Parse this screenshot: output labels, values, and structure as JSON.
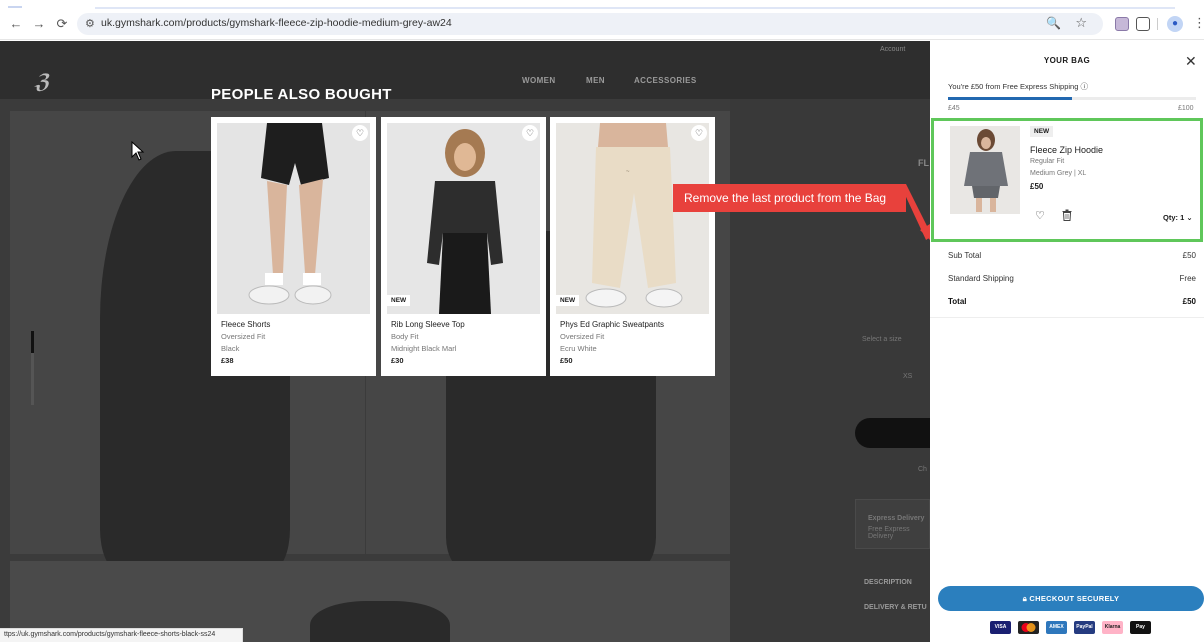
{
  "browser": {
    "url": "uk.gymshark.com/products/gymshark-fleece-zip-hoodie-medium-grey-aw24",
    "status_url": "ttps://uk.gymshark.com/products/gymshark-fleece-shorts-black-ss24"
  },
  "page": {
    "nav": [
      "WOMEN",
      "MEN",
      "ACCESSORIES"
    ],
    "account": "Account",
    "right_partial": {
      "title_fragment": "FL",
      "size_label": "Select a size",
      "ch": "Ch",
      "xs": "XS",
      "express": "Express Delivery",
      "express_sub": "Free Express Delivery",
      "description": "DESCRIPTION",
      "delivery": "DELIVERY & RETU"
    }
  },
  "also_bought": {
    "title": "PEOPLE ALSO BOUGHT",
    "products": [
      {
        "name": "Fleece Shorts",
        "fit": "Oversized Fit",
        "color": "Black",
        "price": "£38",
        "badge": ""
      },
      {
        "name": "Rib Long Sleeve Top",
        "fit": "Body Fit",
        "color": "Midnight Black Marl",
        "price": "£30",
        "badge": "NEW"
      },
      {
        "name": "Phys Ed Graphic Sweatpants",
        "fit": "Oversized Fit",
        "color": "Ecru White",
        "price": "£50",
        "badge": "NEW"
      }
    ]
  },
  "annotation": "Remove the last product from the Bag",
  "bag": {
    "title": "YOUR BAG",
    "shipping_msg": "You're £50 from Free Express Shipping",
    "progress_fraction": 0.5,
    "progress_min": "£45",
    "progress_max": "£100",
    "item": {
      "badge": "NEW",
      "name": "Fleece Zip Hoodie",
      "fit": "Regular Fit",
      "variant": "Medium Grey | XL",
      "price": "£50",
      "qty": "Qty: 1"
    },
    "subtotal_label": "Sub Total",
    "subtotal_value": "£50",
    "shipping_label": "Standard Shipping",
    "shipping_value": "Free",
    "total_label": "Total",
    "total_value": "£50",
    "checkout_label": "CHECKOUT SECURELY",
    "payments": [
      "VISA",
      "",
      "AMEX",
      "PayPal",
      "Klarna",
      "Pay"
    ]
  },
  "colors": {
    "accent": "#2b7fbe",
    "highlight": "#5fc75a",
    "annotation": "#e8413c"
  }
}
